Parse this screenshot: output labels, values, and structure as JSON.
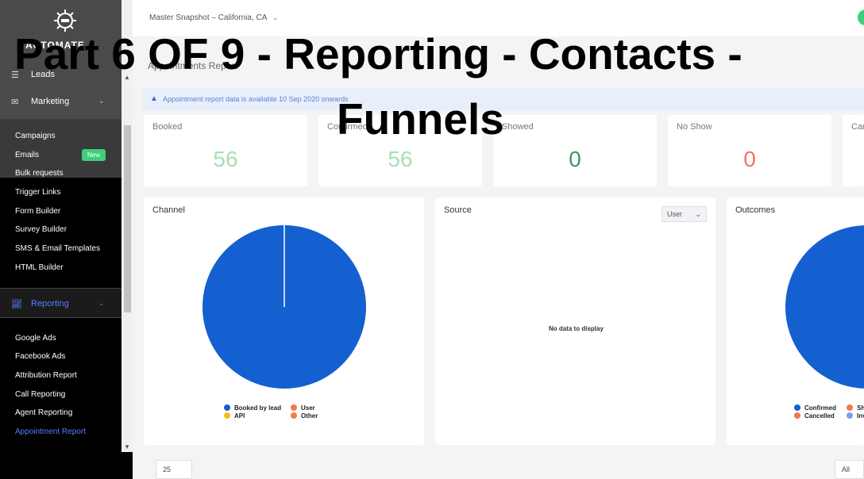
{
  "overlay": {
    "line1": "Part 6 OF 9 - Reporting - Contacts -",
    "line2": "Funnels"
  },
  "header": {
    "location": "Master Snapshot – California, CA"
  },
  "sidebar": {
    "logo_text": "AUTOMATE",
    "leads": "Leads",
    "marketing": "Marketing",
    "marketing_items": [
      "Campaigns",
      "Emails",
      "Bulk requests",
      "Trigger Links",
      "Form Builder",
      "Survey Builder",
      "SMS & Email Templates",
      "HTML Builder"
    ],
    "new_badge": "New",
    "reporting": "Reporting",
    "reporting_items": [
      "Google Ads",
      "Facebook Ads",
      "Attribution Report",
      "Call Reporting",
      "Agent Reporting",
      "Appointment Report"
    ]
  },
  "page": {
    "title": "Appointments Report",
    "info": "Appointment report data is available 10 Sep 2020 onwards"
  },
  "stats": [
    {
      "label": "Booked",
      "value": "56",
      "color": "#a6dfb6"
    },
    {
      "label": "Confirmed",
      "value": "56",
      "color": "#a6dfb6"
    },
    {
      "label": "Showed",
      "value": "0",
      "color": "#3a9a5b"
    },
    {
      "label": "No Show",
      "value": "0",
      "color": "#f0736b"
    },
    {
      "label": "Cancelled",
      "value": ""
    }
  ],
  "channel": {
    "title": "Channel",
    "legend": [
      {
        "name": "Booked by lead",
        "color": "#1560d0"
      },
      {
        "name": "User",
        "color": "#f07a4c"
      },
      {
        "name": "API",
        "color": "#f2c014"
      },
      {
        "name": "Other",
        "color": "#f07a4c"
      }
    ]
  },
  "source": {
    "title": "Source",
    "select": "User",
    "no_data": "No data to display"
  },
  "outcomes": {
    "title": "Outcomes",
    "legend": [
      {
        "name": "Confirmed",
        "color": "#1560d0"
      },
      {
        "name": "Sh",
        "color": "#f07a4c"
      },
      {
        "name": "Cancelled",
        "color": "#f07a4c"
      },
      {
        "name": "Inv",
        "color": "#7aa0f0"
      }
    ]
  },
  "bottom": {
    "page_size": "25",
    "filter": "All"
  }
}
